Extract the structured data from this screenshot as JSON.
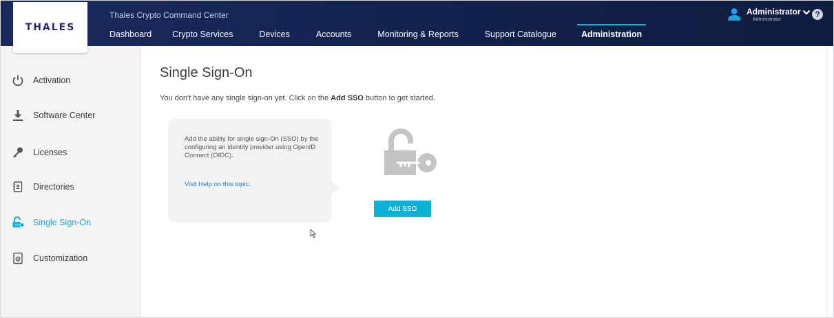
{
  "header": {
    "logo": "THALES",
    "app_title": "Thales Crypto Command Center",
    "nav": [
      {
        "label": "Dashboard"
      },
      {
        "label": "Crypto Services"
      },
      {
        "label": "Devices"
      },
      {
        "label": "Accounts"
      },
      {
        "label": "Monitoring & Reports"
      },
      {
        "label": "Support Catalogue"
      },
      {
        "label": "Administration"
      }
    ],
    "active_nav": "Administration",
    "user": {
      "name": "Administrator",
      "role": "Administrator"
    },
    "help": "?"
  },
  "sidebar": {
    "items": [
      {
        "label": "Activation",
        "icon": "power-icon"
      },
      {
        "label": "Software Center",
        "icon": "download-icon"
      },
      {
        "label": "Licenses",
        "icon": "key-icon"
      },
      {
        "label": "Directories",
        "icon": "contacts-book-icon"
      },
      {
        "label": "Single Sign-On",
        "icon": "lock-key-icon"
      },
      {
        "label": "Customization",
        "icon": "settings-document-icon"
      }
    ],
    "active": "Single Sign-On"
  },
  "main": {
    "title": "Single Sign-On",
    "description_prefix": "You don't have any single sign-on yet. Click on the ",
    "description_bold": "Add SSO",
    "description_suffix": " button to get started.",
    "info_text": "Add the ability for single sign-On (SSO) by the configuring an identity provider using OpenID Connect (OIDC).",
    "help_link": "Visit Help on this topic.",
    "add_button": "Add SSO"
  },
  "colors": {
    "header_bg": "#14234f",
    "accent": "#0ab2d8",
    "sidebar_bg": "#f4f4f5",
    "link": "#2a7ab8"
  }
}
